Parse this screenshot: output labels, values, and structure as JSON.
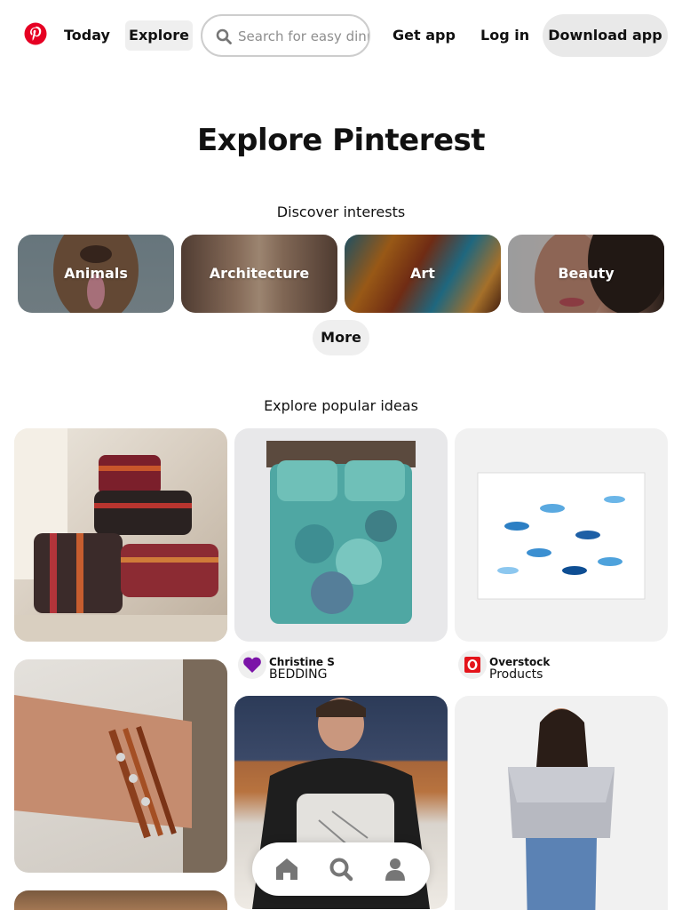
{
  "header": {
    "nav": {
      "today": "Today",
      "explore": "Explore",
      "get_app": "Get app",
      "log_in": "Log in",
      "download_app": "Download app"
    },
    "search": {
      "placeholder": "Search for easy dinners",
      "value": ""
    },
    "brand_color": "#e60023"
  },
  "main": {
    "title": "Explore Pinterest",
    "discover_label": "Discover interests",
    "interests": [
      {
        "label": "Animals"
      },
      {
        "label": "Architecture"
      },
      {
        "label": "Art"
      },
      {
        "label": "Beauty"
      }
    ],
    "more_label": "More",
    "popular_label": "Explore popular ideas",
    "pins": [
      {
        "author": "Christine S",
        "board": "BEDDING"
      },
      {
        "author": "Overstock",
        "board": "Products"
      }
    ]
  },
  "bottom_nav": {
    "items": [
      "home-icon",
      "search-icon",
      "profile-icon"
    ]
  }
}
